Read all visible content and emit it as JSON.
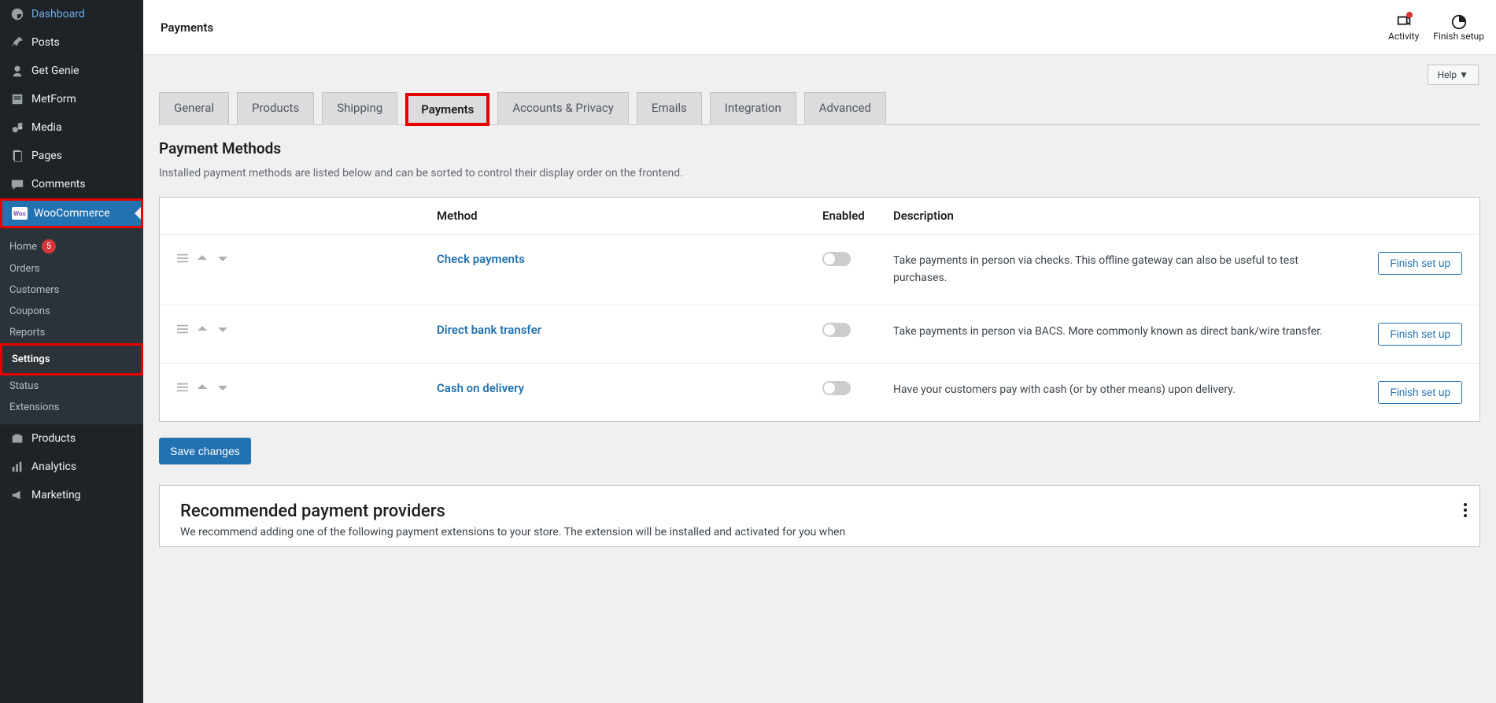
{
  "topbar": {
    "title": "Payments",
    "activity": "Activity",
    "finish": "Finish setup"
  },
  "help": "Help ▼",
  "sidebar": {
    "items": [
      {
        "label": "Dashboard"
      },
      {
        "label": "Posts"
      },
      {
        "label": "Get Genie"
      },
      {
        "label": "MetForm"
      },
      {
        "label": "Media"
      },
      {
        "label": "Pages"
      },
      {
        "label": "Comments"
      },
      {
        "label": "WooCommerce"
      },
      {
        "label": "Products"
      },
      {
        "label": "Analytics"
      },
      {
        "label": "Marketing"
      }
    ],
    "sub": {
      "home": "Home",
      "home_badge": "5",
      "orders": "Orders",
      "customers": "Customers",
      "coupons": "Coupons",
      "reports": "Reports",
      "settings": "Settings",
      "status": "Status",
      "extensions": "Extensions"
    }
  },
  "tabs": [
    "General",
    "Products",
    "Shipping",
    "Payments",
    "Accounts & Privacy",
    "Emails",
    "Integration",
    "Advanced"
  ],
  "section": {
    "title": "Payment Methods",
    "desc": "Installed payment methods are listed below and can be sorted to control their display order on the frontend."
  },
  "table": {
    "head": {
      "method": "Method",
      "enabled": "Enabled",
      "description": "Description"
    },
    "rows": [
      {
        "name": "Check payments",
        "desc": "Take payments in person via checks. This offline gateway can also be useful to test purchases.",
        "btn": "Finish set up"
      },
      {
        "name": "Direct bank transfer",
        "desc": "Take payments in person via BACS. More commonly known as direct bank/wire transfer.",
        "btn": "Finish set up"
      },
      {
        "name": "Cash on delivery",
        "desc": "Have your customers pay with cash (or by other means) upon delivery.",
        "btn": "Finish set up"
      }
    ]
  },
  "save": "Save changes",
  "recommend": {
    "title": "Recommended payment providers",
    "desc": "We recommend adding one of the following payment extensions to your store. The extension will be installed and activated for you when"
  }
}
